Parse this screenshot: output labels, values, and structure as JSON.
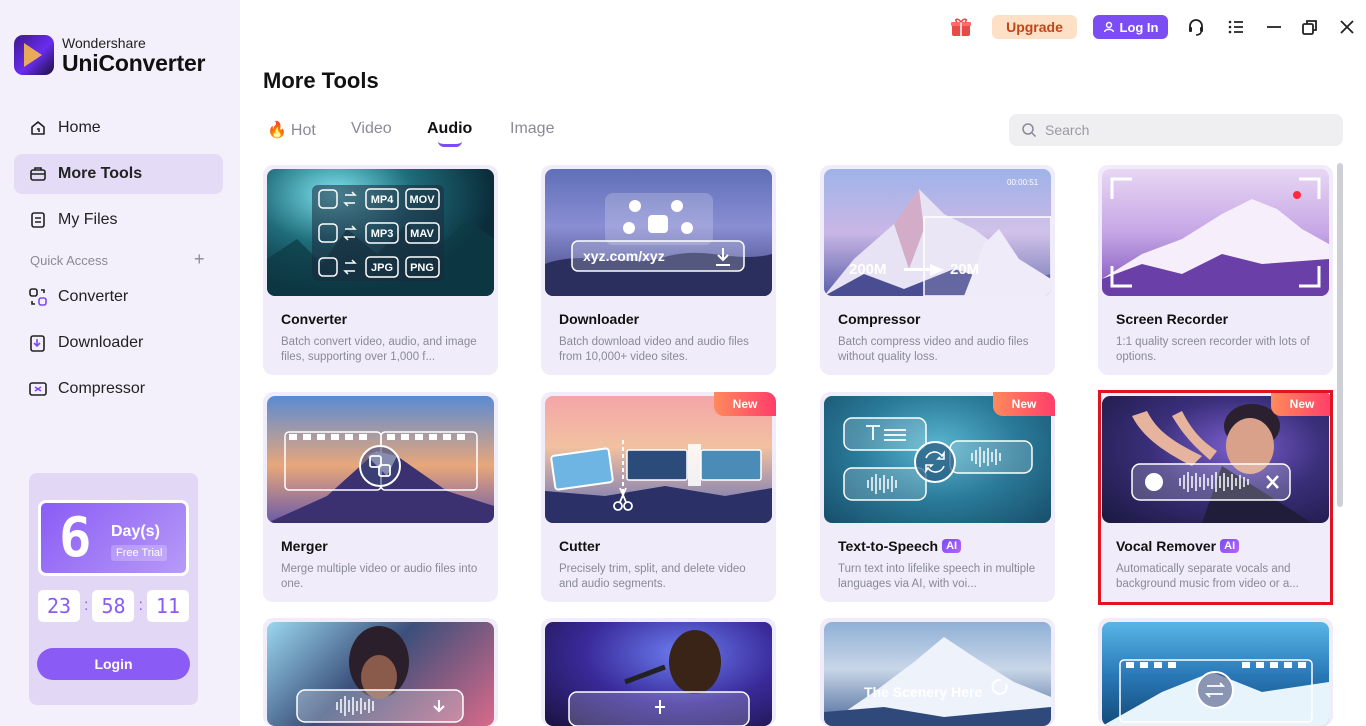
{
  "app": {
    "brand_top": "Wondershare",
    "brand_bottom": "UniConverter"
  },
  "sidebar": {
    "items": [
      {
        "label": "Home",
        "icon": "home-icon"
      },
      {
        "label": "More Tools",
        "icon": "toolbox-icon",
        "active": true
      },
      {
        "label": "My Files",
        "icon": "file-icon"
      }
    ],
    "quick_access_label": "Quick Access",
    "quick_items": [
      {
        "label": "Converter",
        "icon": "converter-icon"
      },
      {
        "label": "Downloader",
        "icon": "downloader-icon"
      },
      {
        "label": "Compressor",
        "icon": "compressor-icon"
      }
    ]
  },
  "trial": {
    "days_number": "6",
    "days_label": "Day(s)",
    "free_trial": "Free Trial",
    "hours": "23",
    "minutes": "58",
    "seconds": "11",
    "login": "Login"
  },
  "topbar": {
    "upgrade": "Upgrade",
    "login": "Log In"
  },
  "main": {
    "title": "More Tools",
    "tabs": [
      {
        "label": "Hot"
      },
      {
        "label": "Video"
      },
      {
        "label": "Audio",
        "active": true
      },
      {
        "label": "Image"
      }
    ],
    "search_placeholder": "Search"
  },
  "cards": [
    {
      "title": "Converter",
      "desc": "Batch convert video, audio, and image files, supporting over 1,000 f...",
      "formats": [
        "MP4",
        "MOV",
        "MP3",
        "MAV",
        "JPG",
        "PNG"
      ]
    },
    {
      "title": "Downloader",
      "desc": "Batch download video and audio files from 10,000+ video sites.",
      "url": "xyz.com/xyz"
    },
    {
      "title": "Compressor",
      "desc": "Batch compress video and audio files without quality loss.",
      "time": "00:00:51",
      "from_size": "200M",
      "to_size": "20M"
    },
    {
      "title": "Screen Recorder",
      "desc": "1:1 quality screen recorder with lots of options."
    },
    {
      "title": "Merger",
      "desc": "Merge multiple video or audio files into one."
    },
    {
      "title": "Cutter",
      "desc": "Precisely trim, split, and delete video and audio segments.",
      "badge": "New"
    },
    {
      "title": "Text-to-Speech",
      "desc": "Turn text into lifelike speech in multiple languages via AI, with voi...",
      "badge": "New",
      "ai": "AI"
    },
    {
      "title": "Vocal Remover",
      "desc": "Automatically separate vocals and background music from video or a...",
      "badge": "New",
      "ai": "AI"
    },
    {
      "title": "",
      "desc": ""
    },
    {
      "title": "",
      "desc": ""
    },
    {
      "title": "",
      "desc": "",
      "overlay": "The Scenery Here"
    },
    {
      "title": "",
      "desc": ""
    }
  ],
  "colors": {
    "accent": "#7b4df2",
    "sidebar_bg": "#f4f0fb",
    "card_bg": "#f0ecfa",
    "highlight": "#e0141e",
    "new_badge": "#ff4d6a"
  }
}
